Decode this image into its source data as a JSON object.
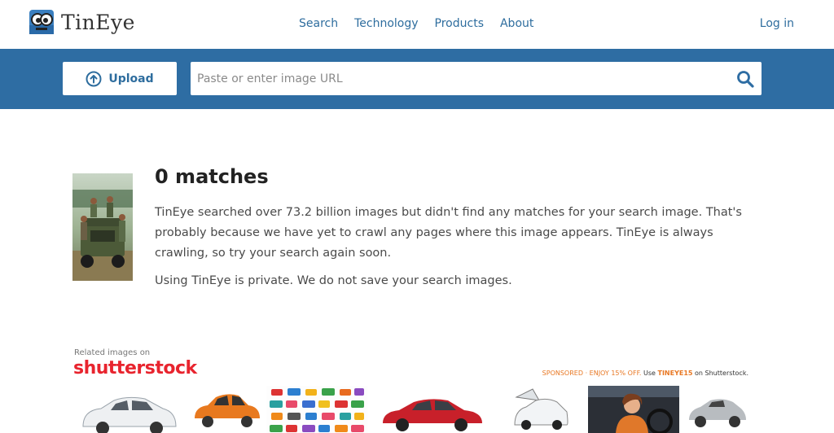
{
  "brand": {
    "name": "TinEye"
  },
  "nav": {
    "items": [
      "Search",
      "Technology",
      "Products",
      "About"
    ],
    "login": "Log in"
  },
  "search": {
    "upload_label": "Upload",
    "url_placeholder": "Paste or enter image URL",
    "url_value": ""
  },
  "result": {
    "title": "0 matches",
    "description": "TinEye searched over 73.2 billion images but didn't find any matches for your search image. That's probably because we have yet to crawl any pages where this image appears. TinEye is always crawling, so try your search again soon.",
    "privacy": "Using TinEye is private. We do not save your search images."
  },
  "related": {
    "label": "Related images on",
    "provider": "shutterstock",
    "sponsored": "SPONSORED",
    "offer": "ENJOY 15% OFF.",
    "use": "Use",
    "code": "TINEYE15",
    "on": "on Shutterstock."
  },
  "colors": {
    "band": "#2e6da3",
    "link": "#2e6d9e",
    "brand_red": "#e8242e",
    "sponsor_orange": "#e87722"
  },
  "icons": {
    "logo": "tineye-robot-icon",
    "upload": "upload-arrow-icon",
    "search": "magnifier-icon"
  }
}
